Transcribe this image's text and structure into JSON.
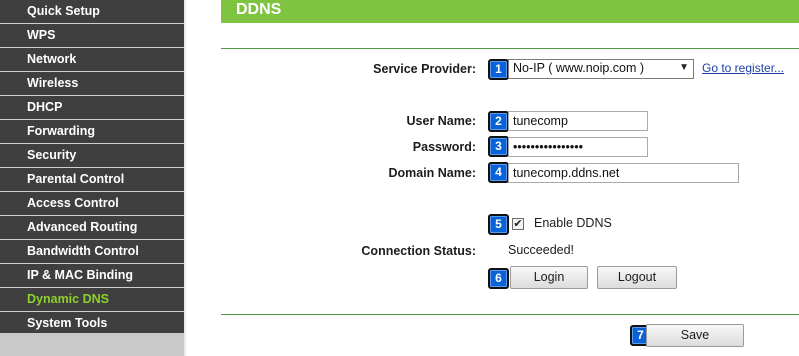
{
  "sidebar": {
    "items": [
      {
        "label": "Quick Setup"
      },
      {
        "label": "WPS"
      },
      {
        "label": "Network"
      },
      {
        "label": "Wireless"
      },
      {
        "label": "DHCP"
      },
      {
        "label": "Forwarding"
      },
      {
        "label": "Security"
      },
      {
        "label": "Parental Control"
      },
      {
        "label": "Access Control"
      },
      {
        "label": "Advanced Routing"
      },
      {
        "label": "Bandwidth Control"
      },
      {
        "label": "IP & MAC Binding"
      },
      {
        "label": "Dynamic DNS",
        "active": true
      },
      {
        "label": "System Tools"
      }
    ],
    "active_color": "#8dd12b"
  },
  "header": {
    "title": "DDNS",
    "color": "#7ec440"
  },
  "form": {
    "service_provider": {
      "label": "Service Provider:",
      "value": "No-IP ( www.noip.com )",
      "badge": "1"
    },
    "register_link": "Go to register...",
    "user_name": {
      "label": "User Name:",
      "value": "tunecomp",
      "badge": "2"
    },
    "password": {
      "label": "Password:",
      "value": "tunecomp12345678",
      "badge": "3"
    },
    "domain_name": {
      "label": "Domain Name:",
      "value": "tunecomp.ddns.net",
      "badge": "4"
    },
    "enable_ddns": {
      "label": "Enable DDNS",
      "checked": true,
      "badge": "5"
    },
    "connection_status": {
      "label": "Connection Status:",
      "value": "Succeeded!"
    },
    "login_button": {
      "label": "Login",
      "badge": "6"
    },
    "logout_button": {
      "label": "Logout"
    },
    "save_button": {
      "label": "Save",
      "badge": "7"
    }
  },
  "icons": {
    "dropdown": "chevron-down-icon",
    "checkbox": "check-icon"
  },
  "colors": {
    "badge": "#0a62d8",
    "link": "#1f3fa6"
  }
}
